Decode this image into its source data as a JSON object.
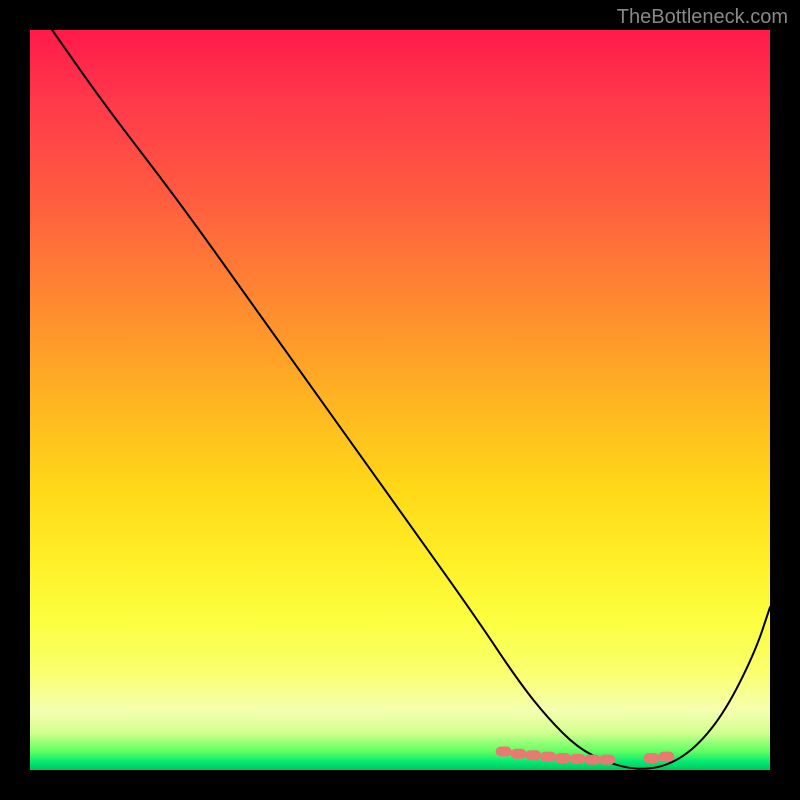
{
  "watermark": "TheBottleneck.com",
  "chart_data": {
    "type": "line",
    "title": "",
    "xlabel": "",
    "ylabel": "",
    "xlim": [
      0,
      100
    ],
    "ylim": [
      0,
      100
    ],
    "grid": false,
    "legend": false,
    "series": [
      {
        "name": "curve",
        "x": [
          3,
          10,
          20,
          30,
          40,
          50,
          60,
          66,
          70,
          74,
          78,
          82,
          86,
          90,
          94,
          98,
          100
        ],
        "y": [
          100,
          90,
          77,
          63,
          49,
          35,
          21,
          12,
          7,
          3,
          1,
          0,
          0.5,
          3,
          8,
          16,
          22
        ]
      }
    ],
    "markers": {
      "name": "highlight-band",
      "x": [
        64,
        66,
        68,
        70,
        72,
        74,
        76,
        78,
        84,
        86
      ],
      "y": [
        2.5,
        2.2,
        2.0,
        1.8,
        1.6,
        1.5,
        1.4,
        1.4,
        1.6,
        1.8
      ]
    },
    "gradient_stops": [
      {
        "pos": 0,
        "color": "#ff1a4a"
      },
      {
        "pos": 50,
        "color": "#ffba20"
      },
      {
        "pos": 85,
        "color": "#f8ff60"
      },
      {
        "pos": 100,
        "color": "#00c853"
      }
    ]
  }
}
